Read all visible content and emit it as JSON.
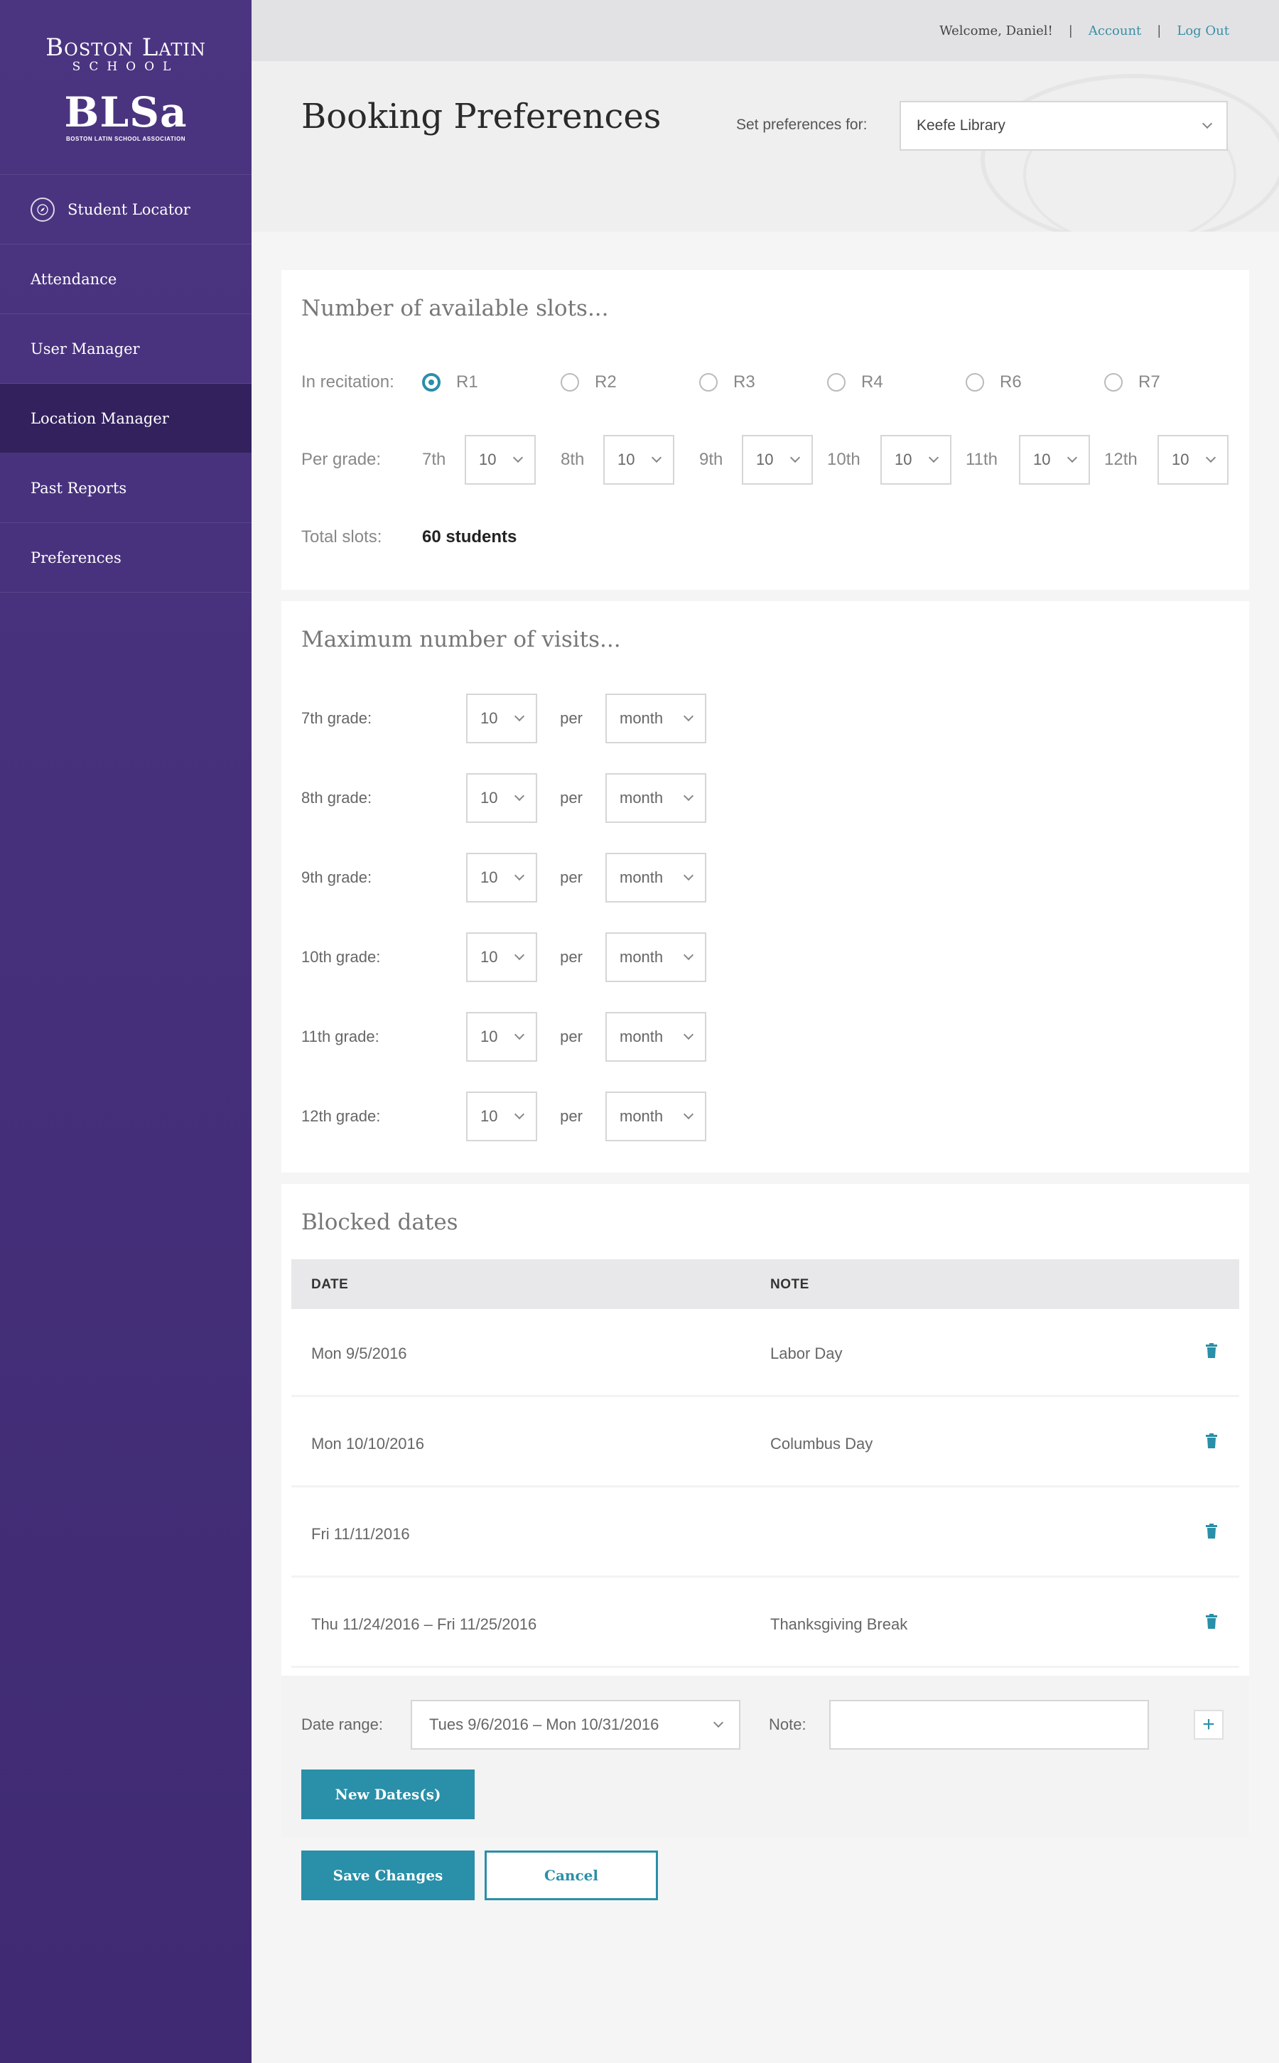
{
  "sidebar": {
    "logo_school": "Boston Latin",
    "logo_school_sub": "SCHOOL",
    "logo_blsa": "BLSa",
    "logo_blsa_sub": "BOSTON LATIN SCHOOL ASSOCIATION",
    "items": [
      {
        "label": "Student Locator",
        "icon": "compass-icon"
      },
      {
        "label": "Attendance"
      },
      {
        "label": "User Manager"
      },
      {
        "label": "Location Manager",
        "active": true
      },
      {
        "label": "Past Reports"
      },
      {
        "label": "Preferences"
      }
    ]
  },
  "topbar": {
    "welcome": "Welcome, Daniel!",
    "sep": "|",
    "account": "Account",
    "logout": "Log Out"
  },
  "header": {
    "title": "Booking Preferences",
    "pref_label": "Set preferences for:",
    "pref_value": "Keefe Library"
  },
  "slots": {
    "title": "Number of available slots...",
    "recitation_label": "In recitation:",
    "recitations": [
      "R1",
      "R2",
      "R3",
      "R4",
      "R6",
      "R7"
    ],
    "selected_recitation": "R1",
    "per_grade_label": "Per grade:",
    "grades": [
      {
        "label": "7th",
        "value": "10"
      },
      {
        "label": "8th",
        "value": "10"
      },
      {
        "label": "9th",
        "value": "10"
      },
      {
        "label": "10th",
        "value": "10"
      },
      {
        "label": "11th",
        "value": "10"
      },
      {
        "label": "12th",
        "value": "10"
      }
    ],
    "total_label": "Total slots:",
    "total_value": "60 students"
  },
  "visits": {
    "title": "Maximum number of visits...",
    "per": "per",
    "rows": [
      {
        "label": "7th grade:",
        "value": "10",
        "period": "month"
      },
      {
        "label": "8th grade:",
        "value": "10",
        "period": "month"
      },
      {
        "label": "9th grade:",
        "value": "10",
        "period": "month"
      },
      {
        "label": "10th grade:",
        "value": "10",
        "period": "month"
      },
      {
        "label": "11th grade:",
        "value": "10",
        "period": "month"
      },
      {
        "label": "12th grade:",
        "value": "10",
        "period": "month"
      }
    ]
  },
  "blocked": {
    "title": "Blocked dates",
    "col_date": "DATE",
    "col_note": "NOTE",
    "rows": [
      {
        "date": "Mon 9/5/2016",
        "note": "Labor Day"
      },
      {
        "date": "Mon 10/10/2016",
        "note": "Columbus Day"
      },
      {
        "date": "Fri 11/11/2016",
        "note": ""
      },
      {
        "date": "Thu 11/24/2016 – Fri 11/25/2016",
        "note": "Thanksgiving Break"
      }
    ],
    "date_range_label": "Date range:",
    "date_range_value": "Tues 9/6/2016 – Mon 10/31/2016",
    "note_label": "Note:",
    "note_value": "",
    "add_symbol": "+",
    "new_dates_button": "New Dates(s)"
  },
  "actions": {
    "save": "Save Changes",
    "cancel": "Cancel"
  },
  "colors": {
    "sidebar": "#4b3581",
    "sidebar_active": "#33215e",
    "accent": "#2a8fa8"
  }
}
